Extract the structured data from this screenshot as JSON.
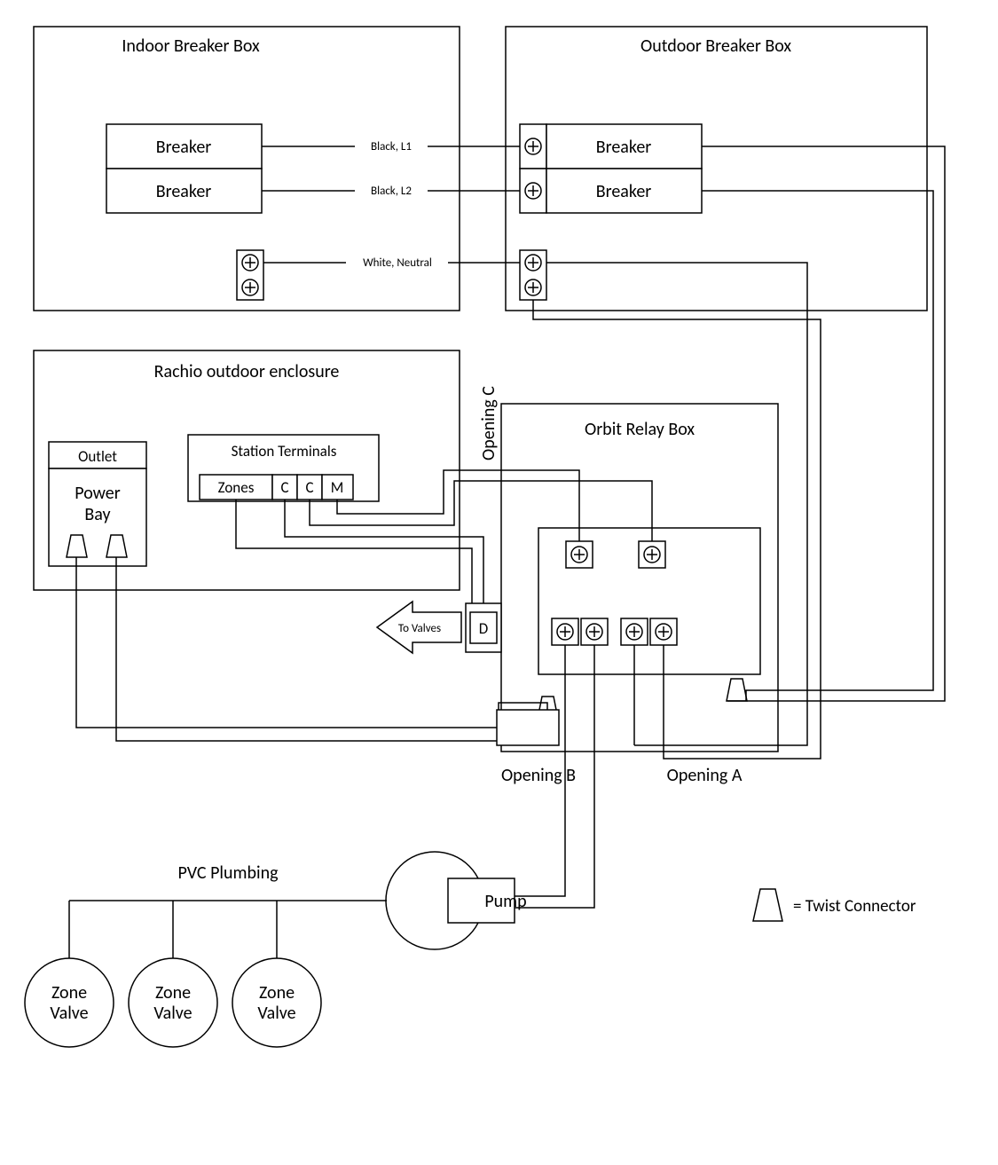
{
  "boxes": {
    "indoor_breaker": "Indoor Breaker Box",
    "outdoor_breaker": "Outdoor Breaker Box",
    "orbit_relay": "Orbit Relay Box",
    "rachio_enclosure": "Rachio outdoor enclosure",
    "outlet": "Outlet",
    "power_bay": "Power\nBay",
    "station_terminals": "Station Terminals",
    "breaker": "Breaker"
  },
  "terminals": {
    "zones": "Zones",
    "c1": "C",
    "c2": "C",
    "m": "M",
    "d": "D"
  },
  "wires": {
    "black_l1": "Black, L1",
    "black_l2": "Black, L2",
    "white_neutral": "White, Neutral",
    "to_valves": "To Valves"
  },
  "openings": {
    "a": "Opening A",
    "b": "Opening B",
    "c": "Opening C"
  },
  "plumbing": {
    "pvc": "PVC Plumbing",
    "zone_valve": "Zone\nValve",
    "pump": "Pump"
  },
  "legend": {
    "twist_connector": "= Twist Connector"
  }
}
